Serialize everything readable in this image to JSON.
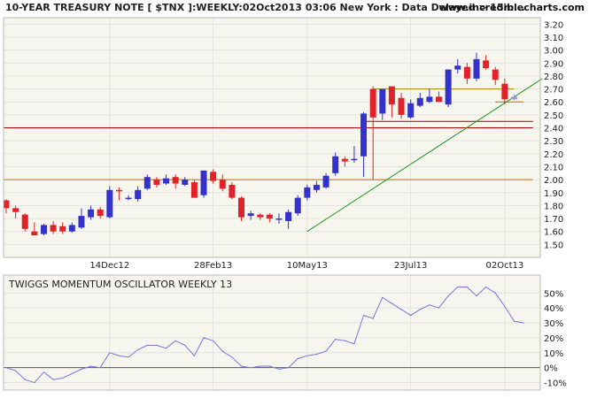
{
  "header": {
    "title": "10-YEAR TREASURY NOTE [ $TNX ]:WEEKLY:02Oct2013 03:06 New York : Data Delayed > 15m...",
    "site": "www.incrediblecharts.com"
  },
  "colors": {
    "background": "#f7f6ee",
    "grid": "#e2e2e2",
    "up": "#3333cc",
    "down": "#e0222a",
    "last_candle": "#9999dd",
    "trend": "#1a9a1a",
    "support_low": "#cc6a00",
    "support_high": "#9a8a00",
    "resistance": "#aa0000",
    "oscillator_line": "#7777dd",
    "oscillator_zero": "#555555",
    "text": "#222222"
  },
  "chart_data": [
    {
      "type": "candlestick",
      "ylim": [
        1.4,
        3.25
      ],
      "y_ticks": [
        1.5,
        1.6,
        1.7,
        1.8,
        1.9,
        2.0,
        2.1,
        2.2,
        2.3,
        2.4,
        2.5,
        2.6,
        2.7,
        2.8,
        2.9,
        3.0,
        3.1,
        3.2
      ],
      "y_tick_labels": [
        "1.50",
        "1.60",
        "1.70",
        "1.80",
        "1.90",
        "2.00",
        "2.10",
        "2.20",
        "2.30",
        "2.40",
        "2.50",
        "2.60",
        "2.70",
        "2.80",
        "2.90",
        "3.00",
        "3.10",
        "3.20"
      ],
      "x_labels": [
        {
          "label": "14Dec12",
          "index": 11
        },
        {
          "label": "28Feb13",
          "index": 22
        },
        {
          "label": "10May13",
          "index": 32
        },
        {
          "label": "23Jul13",
          "index": 43
        },
        {
          "label": "02Oct13",
          "index": 53
        }
      ],
      "grid": true,
      "candles": [
        {
          "o": 1.84,
          "h": 1.85,
          "l": 1.74,
          "c": 1.78
        },
        {
          "o": 1.78,
          "h": 1.8,
          "l": 1.7,
          "c": 1.75
        },
        {
          "o": 1.73,
          "h": 1.74,
          "l": 1.6,
          "c": 1.62
        },
        {
          "o": 1.6,
          "h": 1.67,
          "l": 1.57,
          "c": 1.57
        },
        {
          "o": 1.58,
          "h": 1.66,
          "l": 1.57,
          "c": 1.65
        },
        {
          "o": 1.65,
          "h": 1.68,
          "l": 1.58,
          "c": 1.6
        },
        {
          "o": 1.64,
          "h": 1.67,
          "l": 1.58,
          "c": 1.6
        },
        {
          "o": 1.6,
          "h": 1.67,
          "l": 1.59,
          "c": 1.65
        },
        {
          "o": 1.63,
          "h": 1.78,
          "l": 1.62,
          "c": 1.72
        },
        {
          "o": 1.71,
          "h": 1.8,
          "l": 1.69,
          "c": 1.77
        },
        {
          "o": 1.77,
          "h": 1.79,
          "l": 1.7,
          "c": 1.72
        },
        {
          "o": 1.71,
          "h": 1.95,
          "l": 1.7,
          "c": 1.92
        },
        {
          "o": 1.92,
          "h": 1.94,
          "l": 1.84,
          "c": 1.91
        },
        {
          "o": 1.86,
          "h": 1.88,
          "l": 1.84,
          "c": 1.86
        },
        {
          "o": 1.85,
          "h": 1.95,
          "l": 1.83,
          "c": 1.92
        },
        {
          "o": 1.93,
          "h": 2.04,
          "l": 1.92,
          "c": 2.02
        },
        {
          "o": 2.0,
          "h": 2.02,
          "l": 1.94,
          "c": 1.96
        },
        {
          "o": 1.97,
          "h": 2.04,
          "l": 1.96,
          "c": 2.01
        },
        {
          "o": 2.02,
          "h": 2.04,
          "l": 1.93,
          "c": 1.97
        },
        {
          "o": 1.96,
          "h": 2.02,
          "l": 1.95,
          "c": 2.0
        },
        {
          "o": 1.98,
          "h": 2.0,
          "l": 1.86,
          "c": 1.86
        },
        {
          "o": 1.88,
          "h": 2.07,
          "l": 1.86,
          "c": 2.07
        },
        {
          "o": 2.06,
          "h": 2.08,
          "l": 1.97,
          "c": 1.99
        },
        {
          "o": 2.0,
          "h": 2.04,
          "l": 1.91,
          "c": 1.93
        },
        {
          "o": 1.96,
          "h": 1.98,
          "l": 1.85,
          "c": 1.86
        },
        {
          "o": 1.86,
          "h": 1.87,
          "l": 1.68,
          "c": 1.71
        },
        {
          "o": 1.72,
          "h": 1.76,
          "l": 1.69,
          "c": 1.74
        },
        {
          "o": 1.73,
          "h": 1.74,
          "l": 1.69,
          "c": 1.71
        },
        {
          "o": 1.73,
          "h": 1.74,
          "l": 1.67,
          "c": 1.7
        },
        {
          "o": 1.7,
          "h": 1.74,
          "l": 1.66,
          "c": 1.7
        },
        {
          "o": 1.68,
          "h": 1.77,
          "l": 1.62,
          "c": 1.75
        },
        {
          "o": 1.74,
          "h": 1.88,
          "l": 1.72,
          "c": 1.86
        },
        {
          "o": 1.86,
          "h": 1.96,
          "l": 1.84,
          "c": 1.94
        },
        {
          "o": 1.92,
          "h": 1.99,
          "l": 1.9,
          "c": 1.96
        },
        {
          "o": 1.94,
          "h": 2.05,
          "l": 1.93,
          "c": 2.03
        },
        {
          "o": 2.05,
          "h": 2.21,
          "l": 2.03,
          "c": 2.18
        },
        {
          "o": 2.16,
          "h": 2.18,
          "l": 2.1,
          "c": 2.14
        },
        {
          "o": 2.16,
          "h": 2.26,
          "l": 2.13,
          "c": 2.16
        },
        {
          "o": 2.18,
          "h": 2.52,
          "l": 2.02,
          "c": 2.51
        },
        {
          "o": 2.7,
          "h": 2.72,
          "l": 2.0,
          "c": 2.48
        },
        {
          "o": 2.51,
          "h": 2.7,
          "l": 2.46,
          "c": 2.7
        },
        {
          "o": 2.72,
          "h": 2.72,
          "l": 2.48,
          "c": 2.58
        },
        {
          "o": 2.63,
          "h": 2.67,
          "l": 2.47,
          "c": 2.5
        },
        {
          "o": 2.48,
          "h": 2.62,
          "l": 2.47,
          "c": 2.59
        },
        {
          "o": 2.57,
          "h": 2.67,
          "l": 2.56,
          "c": 2.63
        },
        {
          "o": 2.6,
          "h": 2.7,
          "l": 2.59,
          "c": 2.64
        },
        {
          "o": 2.64,
          "h": 2.68,
          "l": 2.6,
          "c": 2.6
        },
        {
          "o": 2.58,
          "h": 2.85,
          "l": 2.56,
          "c": 2.85
        },
        {
          "o": 2.85,
          "h": 2.93,
          "l": 2.82,
          "c": 2.88
        },
        {
          "o": 2.87,
          "h": 2.9,
          "l": 2.74,
          "c": 2.78
        },
        {
          "o": 2.78,
          "h": 2.98,
          "l": 2.76,
          "c": 2.93
        },
        {
          "o": 2.92,
          "h": 2.96,
          "l": 2.85,
          "c": 2.86
        },
        {
          "o": 2.85,
          "h": 2.87,
          "l": 2.73,
          "c": 2.77
        },
        {
          "o": 2.74,
          "h": 2.78,
          "l": 2.58,
          "c": 2.62
        },
        {
          "o": 2.62,
          "h": 2.66,
          "l": 2.61,
          "c": 2.64
        }
      ],
      "lines": [
        {
          "kind": "resistance",
          "y": 2.45,
          "from_index": 38,
          "to_index": 56
        },
        {
          "kind": "resistance",
          "y": 2.4,
          "from_index": -1,
          "to_index": 56
        },
        {
          "kind": "support_low",
          "y": 2.0,
          "from_index": -1,
          "to_index": 56
        },
        {
          "kind": "support_high",
          "y": 2.7,
          "from_index": 39,
          "to_index": 54
        },
        {
          "kind": "support_low",
          "y": 2.6,
          "from_index": 52,
          "to_index": 55
        },
        {
          "kind": "trend",
          "x1": 32,
          "y1": 1.6,
          "x2": 57,
          "y2": 2.78
        }
      ]
    },
    {
      "type": "line",
      "title": "TWIGGS MOMENTUM OSCILLATOR WEEKLY 13",
      "ylim": [
        -15,
        62
      ],
      "y_ticks": [
        -10,
        0,
        10,
        20,
        30,
        40,
        50
      ],
      "y_tick_labels": [
        "-10%",
        "0%",
        "10%",
        "20%",
        "30%",
        "40%",
        "50%"
      ],
      "zero_line": 0,
      "grid": true,
      "values": [
        0,
        -2,
        -8,
        -10,
        -3,
        -8,
        -7,
        -4,
        -1,
        1,
        0,
        10,
        8,
        7,
        12,
        15,
        15,
        13,
        18,
        15,
        8,
        20,
        18,
        11,
        7,
        1,
        0,
        1,
        1,
        -1,
        0,
        6,
        8,
        9,
        11,
        19,
        18,
        16,
        35,
        33,
        47,
        43,
        39,
        35,
        39,
        42,
        40,
        48,
        54,
        54,
        48,
        54,
        50,
        41,
        31,
        30
      ]
    }
  ]
}
